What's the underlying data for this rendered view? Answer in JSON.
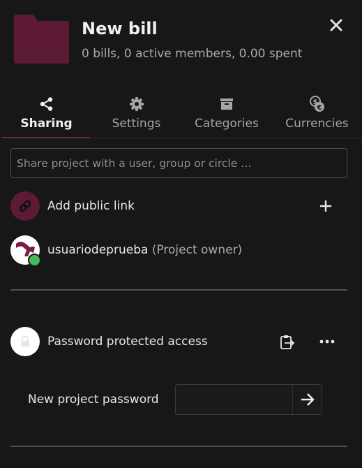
{
  "project": {
    "title": "New bill",
    "summary": "0 bills, 0 active members, 0.00 spent",
    "folder_color": "#5c1a36"
  },
  "tabs": [
    {
      "label": "Sharing",
      "icon": "share-icon",
      "active": true
    },
    {
      "label": "Settings",
      "icon": "gear-icon",
      "active": false
    },
    {
      "label": "Categories",
      "icon": "archive-icon",
      "active": false
    },
    {
      "label": "Currencies",
      "icon": "currency-exchange-icon",
      "active": false
    }
  ],
  "share": {
    "placeholder": "Share project with a user, group or circle …",
    "public_link_label": "Add public link",
    "owner_name": "usuariodeprueba",
    "owner_role": "(Project owner)",
    "password_access_label": "Password protected access",
    "new_password_label": "New project password",
    "new_password_value": ""
  },
  "colors": {
    "accent": "#6b2a44",
    "status_online": "#46ba61",
    "background": "#171717"
  }
}
